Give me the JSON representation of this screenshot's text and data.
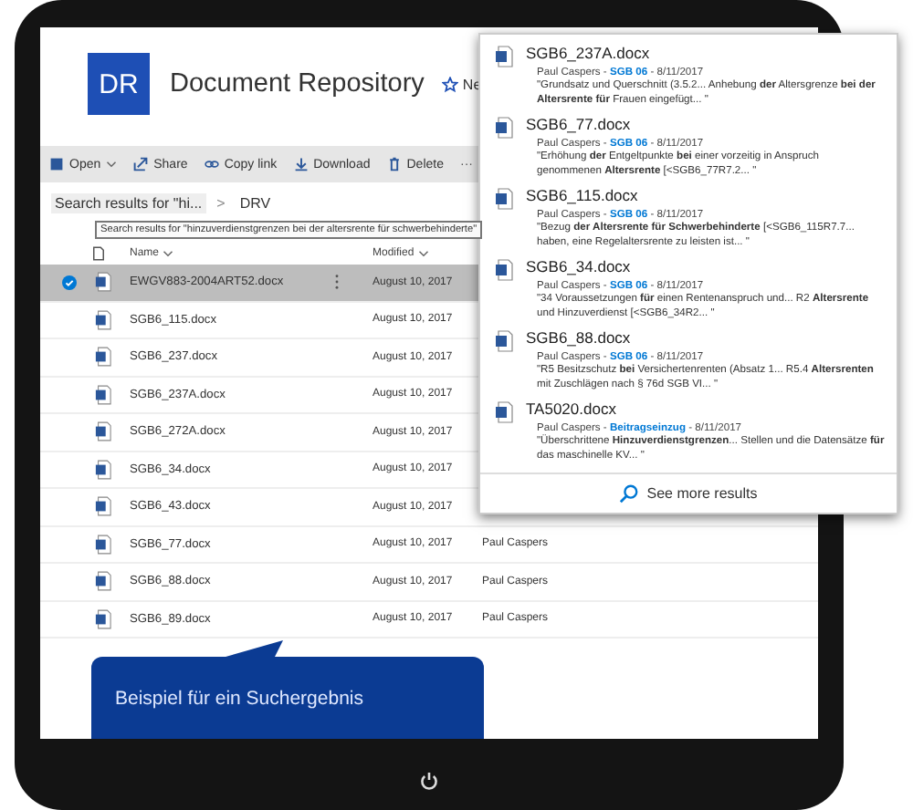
{
  "header": {
    "logo": "DR",
    "title": "Document Repository",
    "new_label": "Ne"
  },
  "toolbar": [
    {
      "label": "Open",
      "kind": "dropdown"
    },
    {
      "label": "Share",
      "kind": "action"
    },
    {
      "label": "Copy link",
      "kind": "action"
    },
    {
      "label": "Download",
      "kind": "action"
    },
    {
      "label": "Delete",
      "kind": "action"
    },
    {
      "label": "···",
      "kind": "more"
    }
  ],
  "breadcrumb": {
    "search": "Search results for \"hi...",
    "separator": ">",
    "current": "DRV"
  },
  "tooltip": "Search results for \"hinzuverdienstgrenzen bei der altersrente für schwerbehinderte\"",
  "columns": [
    {
      "label": "Name"
    },
    {
      "label": "Modified"
    }
  ],
  "rows": [
    {
      "name": "EWGV883-2004ART52.docx",
      "modified": "August 10, 2017",
      "selected": true
    },
    {
      "name": "SGB6_115.docx",
      "modified": "August 10, 2017",
      "selected": false
    },
    {
      "name": "SGB6_237.docx",
      "modified": "August 10, 2017",
      "selected": false
    },
    {
      "name": "SGB6_237A.docx",
      "modified": "August 10, 2017",
      "selected": false
    },
    {
      "name": "SGB6_272A.docx",
      "modified": "August 10, 2017",
      "selected": false
    },
    {
      "name": "SGB6_34.docx",
      "modified": "August 10, 2017",
      "selected": false
    },
    {
      "name": "SGB6_43.docx",
      "modified": "August 10, 2017",
      "selected": false
    },
    {
      "name": "SGB6_77.docx",
      "modified": "August 10, 2017",
      "selected": false,
      "modified_by": "Paul Caspers"
    },
    {
      "name": "SGB6_88.docx",
      "modified": "August 10, 2017",
      "selected": false,
      "modified_by": "Paul Caspers"
    },
    {
      "name": "SGB6_89.docx",
      "modified": "August 10, 2017",
      "selected": false,
      "modified_by": "Paul Caspers"
    }
  ],
  "search_results": {
    "results": [
      {
        "name": "SGB6_237A.docx",
        "author": "Paul Caspers -",
        "source": "SGB 06",
        "date": "- 8/11/2017",
        "snippet": "\"Grundsatz und Querschnitt (3.5.2... Anhebung **der** Altersgrenze **bei der Altersrente für** Frauen eingefügt... \""
      },
      {
        "name": "SGB6_77.docx",
        "author": "Paul Caspers -",
        "source": "SGB 06",
        "date": "- 8/11/2017",
        "snippet": "\"Erhöhung **der** Entgeltpunkte **bei** einer vorzeitig in Anspruch genommenen **Altersrente** [<SGB6_77R7.2... \""
      },
      {
        "name": "SGB6_115.docx",
        "author": "Paul Caspers -",
        "source": "SGB 06",
        "date": "- 8/11/2017",
        "snippet": "\"Bezug **der Altersrente für Schwerbehinderte** [<SGB6_115R7.7... haben, eine Regelaltersrente zu leisten ist... \""
      },
      {
        "name": "SGB6_34.docx",
        "author": "Paul Caspers -",
        "source": "SGB 06",
        "date": "- 8/11/2017",
        "snippet": "\"34 Voraussetzungen **für** einen Rentenanspruch und... R2 **Altersrente** und Hinzuverdienst [<SGB6_34R2... \""
      },
      {
        "name": "SGB6_88.docx",
        "author": "Paul Caspers -",
        "source": "SGB 06",
        "date": "- 8/11/2017",
        "snippet": "\"R5 Besitzschutz **bei** Versichertenrenten (Absatz 1... R5.4 **Altersrenten** mit Zuschlägen nach § 76d SGB VI... \""
      },
      {
        "name": "TA5020.docx",
        "author": "Paul Caspers -",
        "source": "Beitragseinzug",
        "date": "- 8/11/2017",
        "snippet": "\"Überschrittene **Hinzuverdienstgrenzen**... Stellen und die Datensätze **für** das maschinelle KV... \""
      }
    ],
    "more": "See more results"
  },
  "callout": "Beispiel für ein Suchergebnis"
}
